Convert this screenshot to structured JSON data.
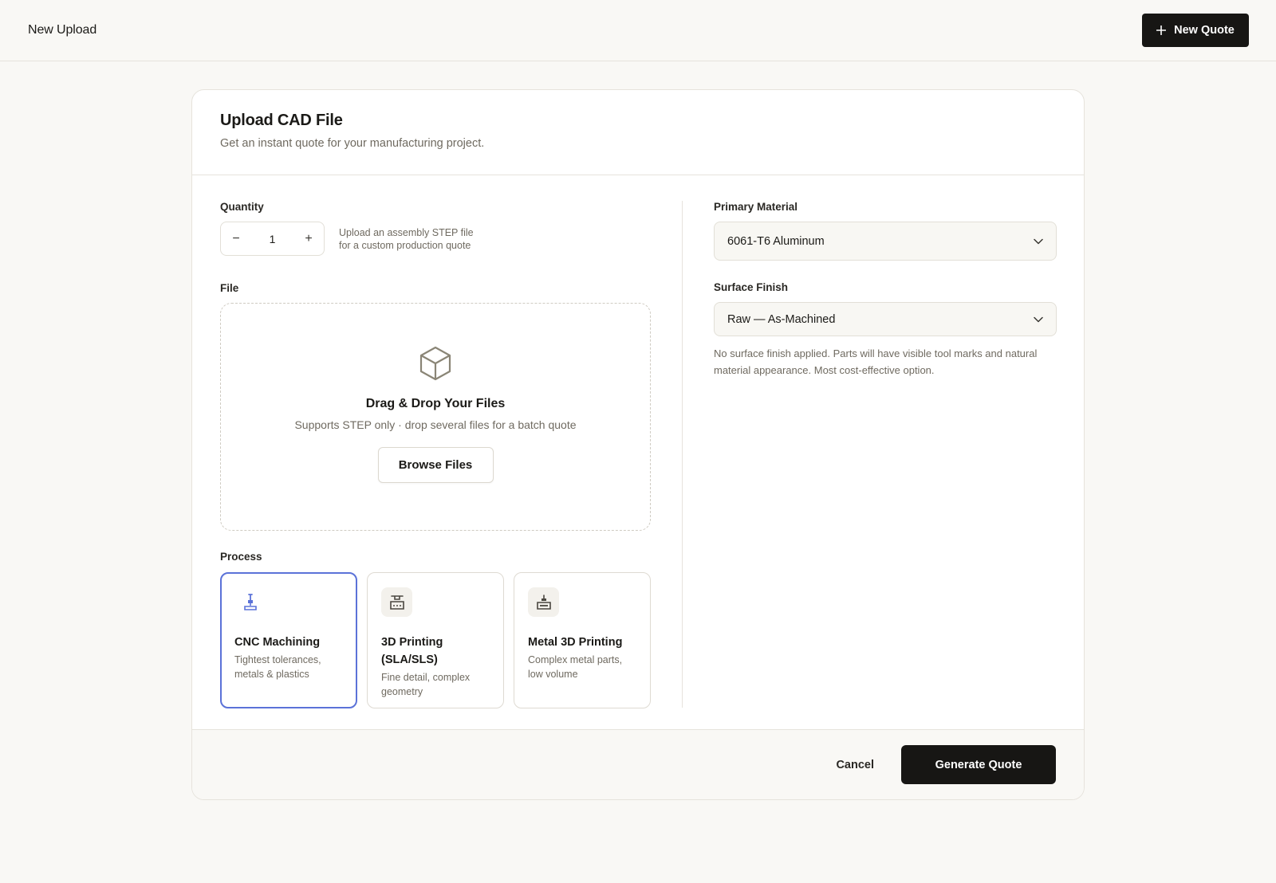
{
  "topbar": {
    "title": "New Upload",
    "new_quote_label": "New Quote"
  },
  "card": {
    "title": "Upload CAD File",
    "subtitle": "Get an instant quote for your manufacturing project."
  },
  "quantity": {
    "label": "Quantity",
    "value": "1",
    "decrement_symbol": "−",
    "increment_symbol": "+",
    "hint_line1": "Upload an assembly STEP file",
    "hint_line2": "for a custom production quote"
  },
  "file": {
    "label": "File",
    "icon": "cube-icon",
    "title": "Drag & Drop Your Files",
    "subtitle": "Supports STEP only · drop several files for a batch quote",
    "browse_label": "Browse Files"
  },
  "process": {
    "label": "Process",
    "selected_color": "#5b72d8",
    "options": [
      {
        "name": "CNC Machining",
        "desc": "Tightest tolerances, metals & plastics",
        "icon": "cnc-mill-icon",
        "selected": true
      },
      {
        "name": "3D Printing (SLA/SLS)",
        "desc": "Fine detail, complex geometry",
        "icon": "3d-printer-icon",
        "selected": false
      },
      {
        "name": "Metal 3D Printing",
        "desc": "Complex metal parts, low volume",
        "icon": "metal-printer-icon",
        "selected": false
      }
    ]
  },
  "material": {
    "label": "Primary Material",
    "value": "6061-T6 Aluminum"
  },
  "finish": {
    "label": "Surface Finish",
    "value": "Raw — As-Machined",
    "description": "No surface finish applied. Parts will have visible tool marks and natural material appearance. Most cost-effective option."
  },
  "footer": {
    "cancel_label": "Cancel",
    "generate_label": "Generate Quote"
  }
}
